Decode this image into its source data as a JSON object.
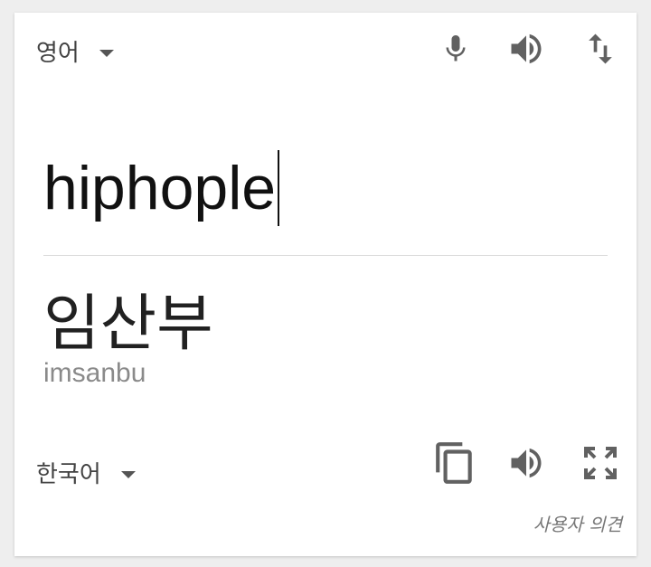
{
  "source": {
    "language": "영어",
    "text": "hiphople",
    "icons": [
      "microphone-icon",
      "speaker-icon",
      "swap-languages-icon"
    ]
  },
  "target": {
    "language": "한국어",
    "text": "임산부",
    "romanization": "imsanbu",
    "icons": [
      "copy-icon",
      "speaker-icon",
      "fullscreen-icon"
    ]
  },
  "feedback_link": "사용자 의견",
  "colors": {
    "icon": "#616161",
    "background": "#eeeeee",
    "card": "#ffffff",
    "romanization": "#8a8a8a"
  }
}
